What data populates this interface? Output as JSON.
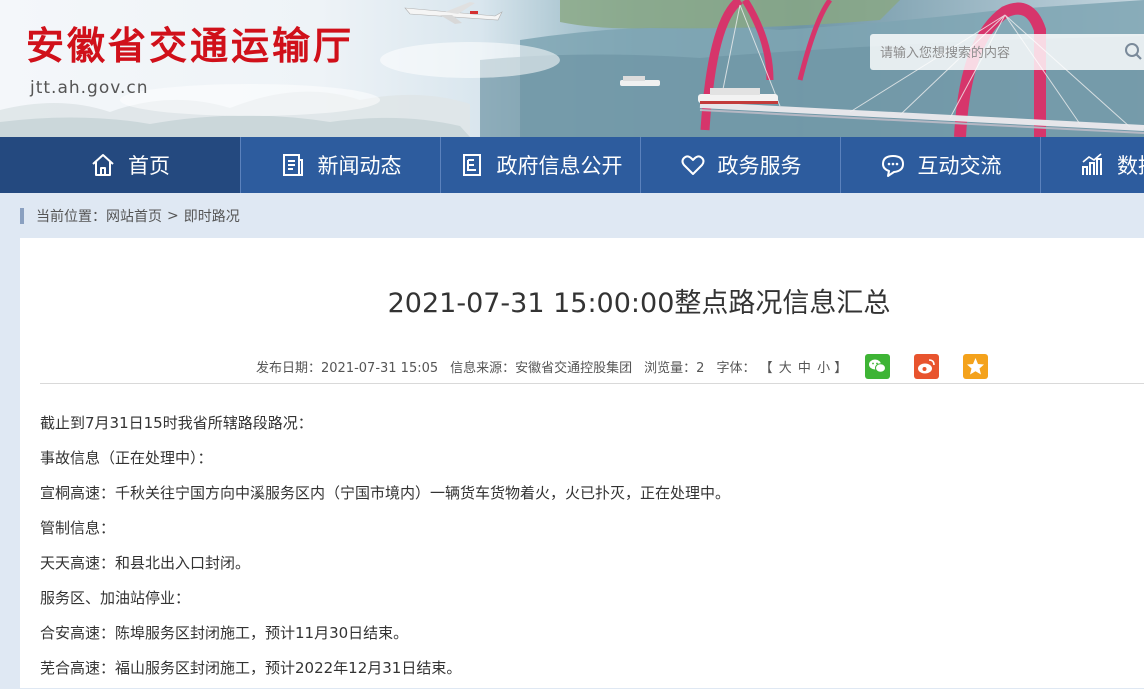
{
  "header": {
    "site_title": "安徽省交通运输厅",
    "site_url": "jtt.ah.gov.cn",
    "search_placeholder": "请输入您想搜索的内容"
  },
  "nav": {
    "items": [
      {
        "label": "首页",
        "icon": "home-icon"
      },
      {
        "label": "新闻动态",
        "icon": "news-icon"
      },
      {
        "label": "政府信息公开",
        "icon": "document-icon"
      },
      {
        "label": "政务服务",
        "icon": "heart-icon"
      },
      {
        "label": "互动交流",
        "icon": "chat-icon"
      },
      {
        "label": "数据",
        "icon": "chart-icon"
      }
    ]
  },
  "breadcrumb": {
    "prefix": "当前位置：",
    "home": "网站首页",
    "separator": ">",
    "current": "即时路况"
  },
  "article": {
    "title": "2021-07-31 15:00:00整点路况信息汇总",
    "meta": {
      "date": "发布日期：2021-07-31 15:05",
      "source": "信息来源：安徽省交通控股集团",
      "views": "浏览量：2",
      "font_label": "字体：",
      "font_open": "【",
      "font_large": "大",
      "font_medium": "中",
      "font_small": "小",
      "font_close": "】"
    },
    "share": [
      "wechat-icon",
      "weibo-icon",
      "qzone-icon"
    ],
    "paragraphs": [
      "截止到7月31日15时我省所辖路段路况：",
      "事故信息（正在处理中）：",
      "宣桐高速：千秋关往宁国方向中溪服务区内（宁国市境内）一辆货车货物着火，火已扑灭，正在处理中。",
      "管制信息：",
      "天天高速：和县北出入口封闭。",
      "服务区、加油站停业：",
      "合安高速：陈埠服务区封闭施工，预计11月30日结束。",
      "芜合高速：福山服务区封闭施工，预计2022年12月31日结束。"
    ]
  },
  "colors": {
    "brand_red": "#d0101a",
    "nav_blue": "#2d5c9e",
    "nav_home": "#24497f",
    "wechat": "#3eb435",
    "weibo": "#e8542e",
    "qzone": "#f4a21b"
  }
}
